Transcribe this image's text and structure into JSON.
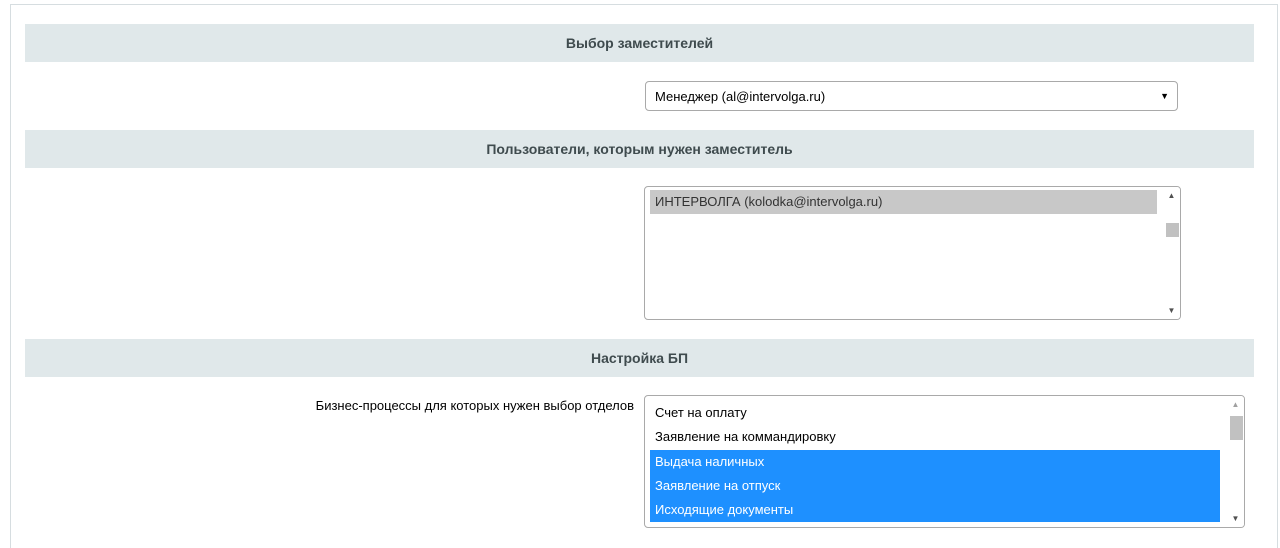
{
  "sections": {
    "deputies_header": "Выбор заместителей",
    "users_header": "Пользователи, которым нужен заместитель",
    "bp_header": "Настройка БП"
  },
  "deputy_select": {
    "selected": "Менеджер (al@intervolga.ru)",
    "arrow_icon": "triangle-down-icon"
  },
  "users_list": {
    "options": [
      {
        "label": "ИНТЕРВОЛГА (kolodka@intervolga.ru)",
        "selected": true
      }
    ]
  },
  "bp_settings": {
    "label": "Бизнес-процессы для которых нужен выбор отделов",
    "options": [
      {
        "label": "Счет на оплату",
        "selected": false
      },
      {
        "label": "Заявление на коммандировку",
        "selected": false
      },
      {
        "label": "Выдача наличных",
        "selected": true
      },
      {
        "label": "Заявление на отпуск",
        "selected": true
      },
      {
        "label": "Исходящие документы",
        "selected": true
      }
    ]
  },
  "colors": {
    "header_bg": "#e0e8ea",
    "selected_blue": "#1e90ff",
    "selected_gray": "#c8c8c8"
  }
}
